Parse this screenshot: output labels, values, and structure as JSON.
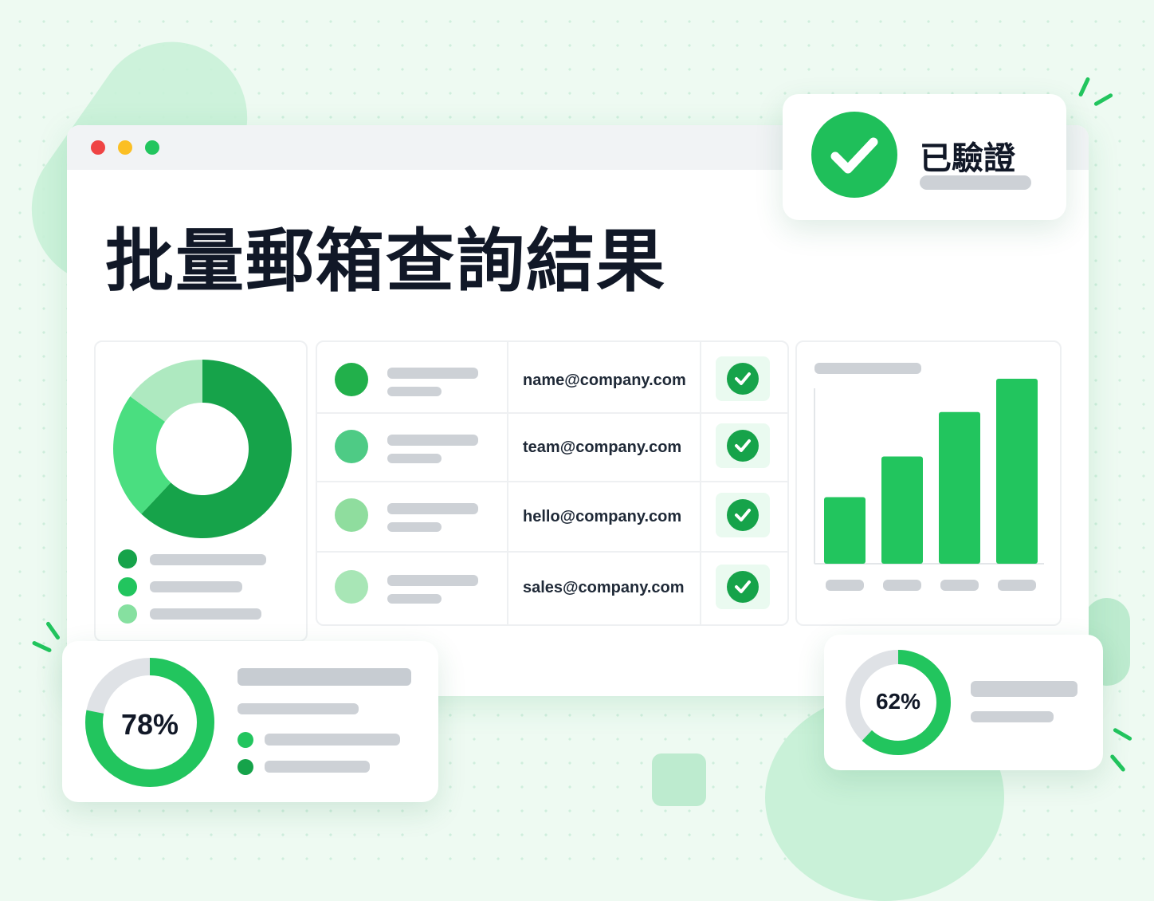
{
  "main": {
    "title": "批量郵箱查詢結果"
  },
  "badge": {
    "label": "已驗證",
    "icon": "check-circle-icon"
  },
  "email_list": {
    "rows": [
      {
        "email": "name@company.com",
        "avatar_color": "#22b04b"
      },
      {
        "email": "team@company.com",
        "avatar_color": "#4ecb85"
      },
      {
        "email": "hello@company.com",
        "avatar_color": "#8fdd9e"
      },
      {
        "email": "sales@company.com",
        "avatar_color": "#a8e6b6"
      }
    ]
  },
  "donut": {
    "slices": [
      {
        "value": 0.62,
        "color": "#16a34a"
      },
      {
        "value": 0.23,
        "color": "#4ade80"
      },
      {
        "value": 0.15,
        "color": "#aee9c0"
      }
    ],
    "legend_colors": [
      "#16a34a",
      "#22c55e",
      "#86e0a0"
    ]
  },
  "bar_chart": {
    "values": [
      0.36,
      0.58,
      0.82,
      1.0
    ],
    "color": "#22c55e"
  },
  "stat_left": {
    "percent": "78%",
    "value": 0.78
  },
  "stat_right": {
    "percent": "62%",
    "value": 0.62
  },
  "colors": {
    "accent": "#22c55e",
    "accent_dark": "#16a34a",
    "placeholder": "#cdd1d6"
  }
}
